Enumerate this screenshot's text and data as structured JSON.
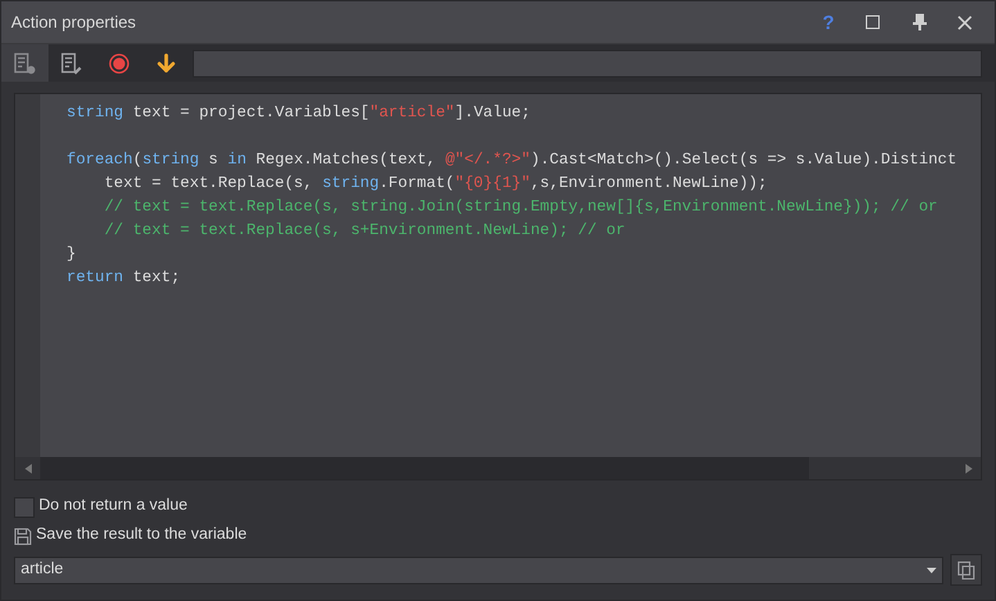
{
  "window": {
    "title": "Action properties",
    "help": "?"
  },
  "toolbar": [
    {
      "kind": "settings",
      "selected": true
    },
    {
      "kind": "edit",
      "selected": false
    },
    {
      "kind": "record",
      "selected": false
    },
    {
      "kind": "down",
      "selected": false
    }
  ],
  "editor": {
    "lines": [
      [
        {
          "kind": "keyword",
          "text": "string"
        },
        {
          "kind": "plain",
          "text": " text = project.Variables["
        },
        {
          "kind": "string",
          "text": "\"article\""
        },
        {
          "kind": "plain",
          "text": "].Value;"
        }
      ],
      [
        {
          "kind": "blank"
        }
      ],
      [
        {
          "kind": "keyword",
          "text": "foreach"
        },
        {
          "kind": "plain",
          "text": "("
        },
        {
          "kind": "keyword",
          "text": "string"
        },
        {
          "kind": "plain",
          "text": " s "
        },
        {
          "kind": "keyword",
          "text": "in"
        },
        {
          "kind": "plain",
          "text": " Regex.Matches(text, "
        },
        {
          "kind": "string",
          "text": "@\"</.*?>\""
        },
        {
          "kind": "plain",
          "text": ").Cast<Match>().Select(s => s.Value).Distinct"
        }
      ],
      [
        {
          "kind": "plain",
          "text": "    text = text.Replace(s, "
        },
        {
          "kind": "keyword",
          "text": "string"
        },
        {
          "kind": "plain",
          "text": ".Format("
        },
        {
          "kind": "string",
          "text": "\"{0}{1}\""
        },
        {
          "kind": "plain",
          "text": ",s,Environment.NewLine));"
        }
      ],
      [
        {
          "kind": "comment",
          "text": "    // text = text.Replace(s, string.Join(string.Empty,new[]{s,Environment.NewLine})); // or"
        }
      ],
      [
        {
          "kind": "comment",
          "text": "    // text = text.Replace(s, s+Environment.NewLine); // or"
        }
      ],
      [
        {
          "kind": "plain",
          "text": "}"
        }
      ],
      [
        {
          "kind": "keyword",
          "text": "return"
        },
        {
          "kind": "plain",
          "text": " text;"
        }
      ]
    ]
  },
  "options": {
    "no_return": {
      "label": "Do not return a value",
      "checked": false
    },
    "save_label": "Save the result to the variable",
    "variable": "article"
  }
}
